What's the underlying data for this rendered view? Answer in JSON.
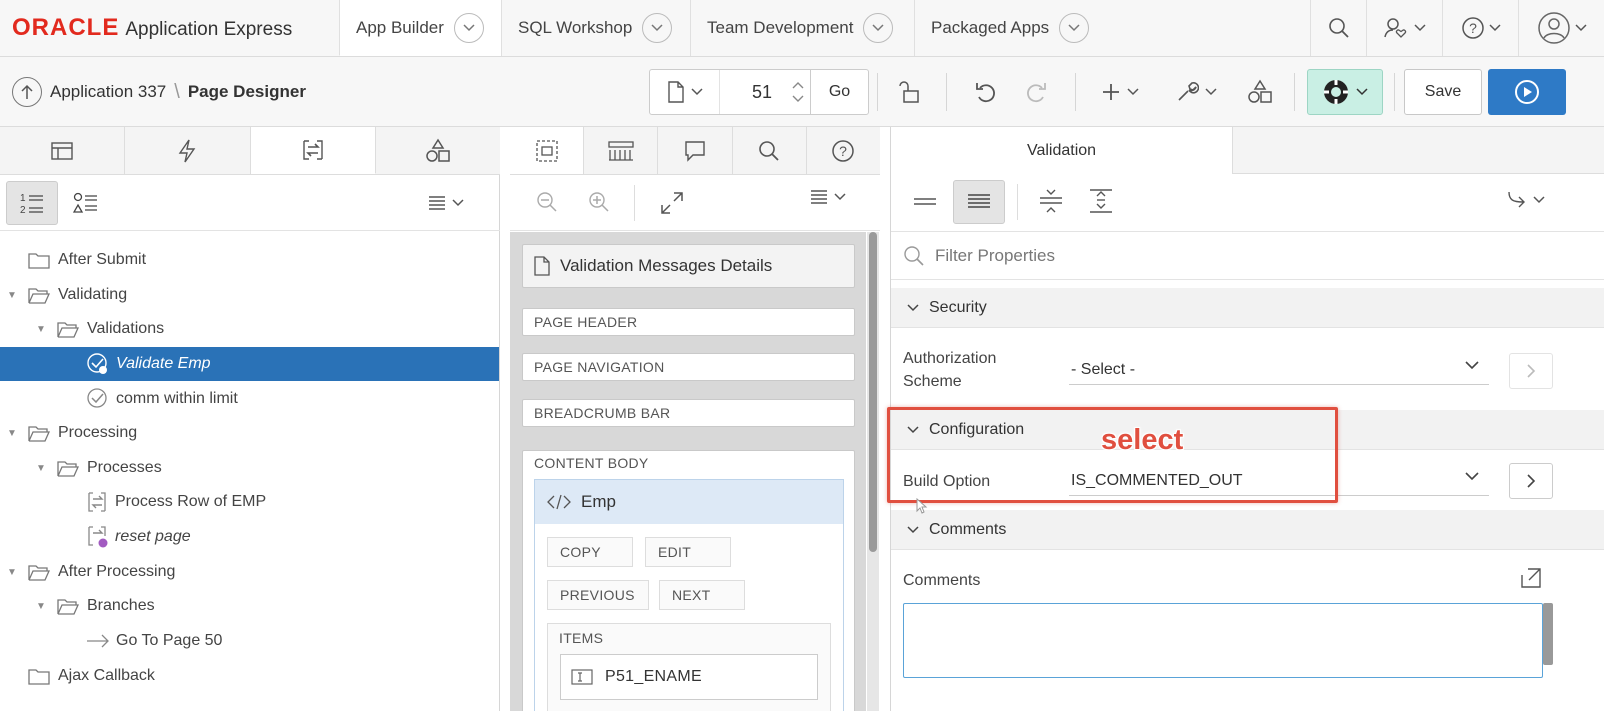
{
  "header": {
    "logo_brand": "ORACLE",
    "logo_product": "Application Express",
    "tabs": [
      {
        "label": "App Builder",
        "active": true
      },
      {
        "label": "SQL Workshop",
        "active": false
      },
      {
        "label": "Team Development",
        "active": false
      },
      {
        "label": "Packaged Apps",
        "active": false
      }
    ],
    "icons": [
      "search-icon",
      "user-heart-icon",
      "help-icon",
      "avatar-icon"
    ]
  },
  "toolbar": {
    "breadcrumb_app": "Application 337",
    "breadcrumb_sep": "\\",
    "breadcrumb_current": "Page Designer",
    "page_number": "51",
    "go_label": "Go",
    "save_label": "Save",
    "icons": [
      "page-icon",
      "lock-icon",
      "undo-icon",
      "redo-icon",
      "add-icon",
      "utilities-wrench-icon",
      "shared-components-icon",
      "help-lifesaver-icon",
      "run-icon"
    ]
  },
  "left": {
    "tabs": [
      "rendering-icon",
      "dynamic-actions-icon",
      "processing-icon",
      "shared-components-icon"
    ],
    "active_tab": 2,
    "tree": [
      {
        "label": "After Submit",
        "icon": "folder-icon",
        "expander": ""
      },
      {
        "label": "Validating",
        "icon": "folder-open-icon",
        "expander": "▼"
      },
      {
        "label": "Validations",
        "icon": "folder-open-icon",
        "expander": "▼"
      },
      {
        "label": "Validate Emp",
        "icon": "validation-icon",
        "expander": "",
        "selected": true
      },
      {
        "label": "comm within limit",
        "icon": "validation-icon",
        "expander": ""
      },
      {
        "label": "Processing",
        "icon": "folder-open-icon",
        "expander": "▼"
      },
      {
        "label": "Processes",
        "icon": "folder-open-icon",
        "expander": "▼"
      },
      {
        "label": "Process Row of EMP",
        "icon": "process-icon",
        "expander": ""
      },
      {
        "label": "reset page",
        "icon": "process-icon",
        "expander": "",
        "italic": true
      },
      {
        "label": "After Processing",
        "icon": "folder-open-icon",
        "expander": "▼"
      },
      {
        "label": "Branches",
        "icon": "folder-open-icon",
        "expander": "▼"
      },
      {
        "label": "Go To Page 50",
        "icon": "arrow-right-icon",
        "expander": ""
      },
      {
        "label": "Ajax Callback",
        "icon": "folder-icon",
        "expander": ""
      }
    ]
  },
  "middle": {
    "tabs": [
      "grid-layout-icon",
      "gallery-icon",
      "messages-icon",
      "search-icon",
      "help-icon"
    ],
    "canvas": {
      "region_title": "Validation Messages Details",
      "slots": [
        "PAGE HEADER",
        "PAGE NAVIGATION",
        "BREADCRUMB BAR",
        "CONTENT BODY"
      ],
      "region_name": "Emp",
      "buttons": [
        "COPY",
        "EDIT",
        "PREVIOUS",
        "NEXT"
      ],
      "items_label": "ITEMS",
      "item": "P51_ENAME"
    }
  },
  "right": {
    "tab_label": "Validation",
    "filter_placeholder": "Filter Properties",
    "sections": {
      "security": "Security",
      "configuration": "Configuration",
      "comments": "Comments"
    },
    "properties": {
      "authorization_label_1": "Authorization",
      "authorization_label_2": "Scheme",
      "authorization_value": "- Select -",
      "build_option_label": "Build Option",
      "build_option_value": "IS_COMMENTED_OUT",
      "comments_label": "Comments",
      "comments_value": ""
    },
    "annotation": "select"
  },
  "colors": {
    "oracle_red": "#e22a1e",
    "selection_blue": "#2a72b7",
    "run_blue": "#2e7ac6",
    "help_green": "#c9efe4",
    "annotation_red": "#e04f3f"
  }
}
